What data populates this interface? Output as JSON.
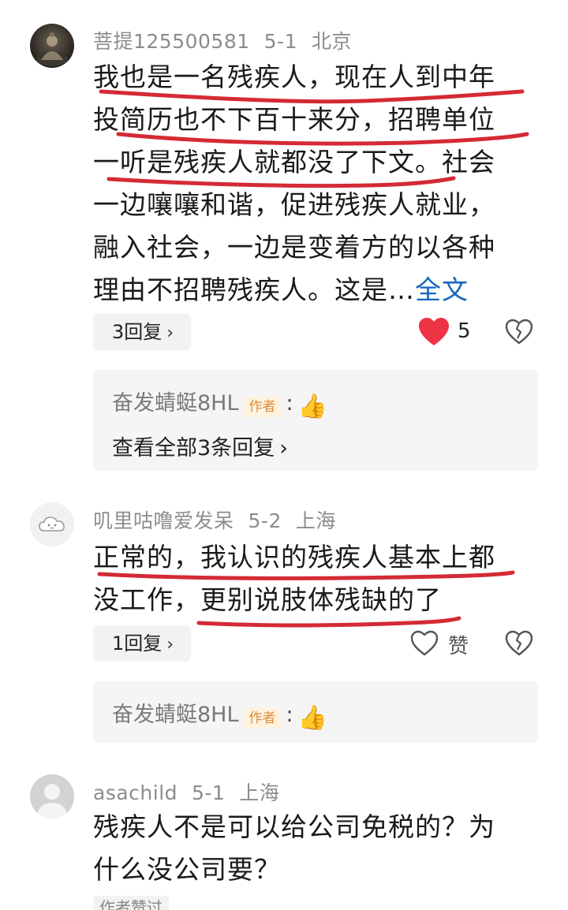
{
  "comments": [
    {
      "username": "菩提125500581",
      "date": "5-1",
      "location": "北京",
      "lines": [
        "我也是一名残疾人，现在人到中年",
        "投简历也不下百十来分，招聘单位",
        "一听是残疾人就都没了下文。社会",
        "一边嚷嚷和谐，促进残疾人就业，",
        "融入社会，一边是变着方的以各种",
        "理由不招聘残疾人。这是…"
      ],
      "more_label": "全文",
      "reply_count_label": "3回复",
      "like_count": "5",
      "reply": {
        "name": "奋发蜻蜓8HL",
        "tag": "作者",
        "colon": ":",
        "emoji": "👍",
        "see_all": "查看全部3条回复"
      }
    },
    {
      "username": "叽里咕噜爱发呆",
      "date": "5-2",
      "location": "上海",
      "lines": [
        "正常的，我认识的残疾人基本上都",
        "没工作，更别说肢体残缺的了"
      ],
      "reply_count_label": "1回复",
      "like_label": "赞",
      "reply": {
        "name": "奋发蜻蜓8HL",
        "tag": "作者",
        "colon": ":",
        "emoji": "👍"
      }
    },
    {
      "username": "asachild",
      "date": "5-1",
      "location": "上海",
      "lines": [
        "残疾人不是可以给公司免税的？为",
        "什么没公司要？"
      ],
      "tag_partial": "作者赞过"
    }
  ],
  "colors": {
    "underline": "#d42a35",
    "link": "#1565c0",
    "like_red": "#ee3344"
  },
  "icons": {
    "like_filled": "heart-filled-icon",
    "like_outline": "heart-outline-icon",
    "dislike": "broken-heart-icon",
    "chevron": "chevron-right-icon"
  }
}
